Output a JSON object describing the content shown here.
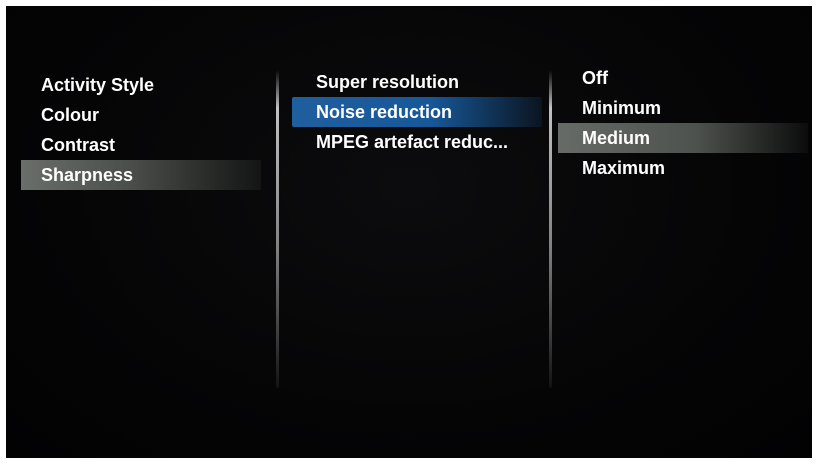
{
  "column_1": {
    "items": [
      "Activity Style",
      "Colour",
      "Contrast",
      "Sharpness"
    ],
    "selected": "Sharpness"
  },
  "column_2": {
    "items": [
      "Super resolution",
      "Noise reduction",
      "MPEG artefact reduc..."
    ],
    "selected": "Noise reduction"
  },
  "column_3": {
    "items": [
      "Off",
      "Minimum",
      "Medium",
      "Maximum"
    ],
    "selected": "Medium"
  },
  "colors": {
    "background": "#050506",
    "text": "#ffffff",
    "focus_highlight_blue": "#1f5f9e",
    "selected_highlight_grey": "#5a5e5a"
  }
}
